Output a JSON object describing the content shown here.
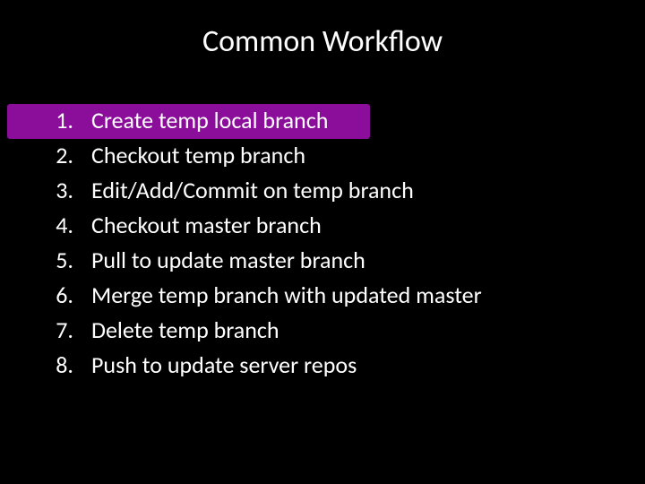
{
  "title": "Common Workflow",
  "items": [
    {
      "num": "1.",
      "text": "Create temp local branch"
    },
    {
      "num": "2.",
      "text": "Checkout temp branch"
    },
    {
      "num": "3.",
      "text": "Edit/Add/Commit on temp branch"
    },
    {
      "num": "4.",
      "text": "Checkout master branch"
    },
    {
      "num": "5.",
      "text": "Pull to update master branch"
    },
    {
      "num": "6.",
      "text": "Merge temp branch with updated master"
    },
    {
      "num": "7.",
      "text": "Delete temp branch"
    },
    {
      "num": "8.",
      "text": "Push to update server repos"
    }
  ],
  "highlighted_index": 0,
  "colors": {
    "background": "#000000",
    "text": "#ffffff",
    "highlight": "#8a0e9a"
  }
}
